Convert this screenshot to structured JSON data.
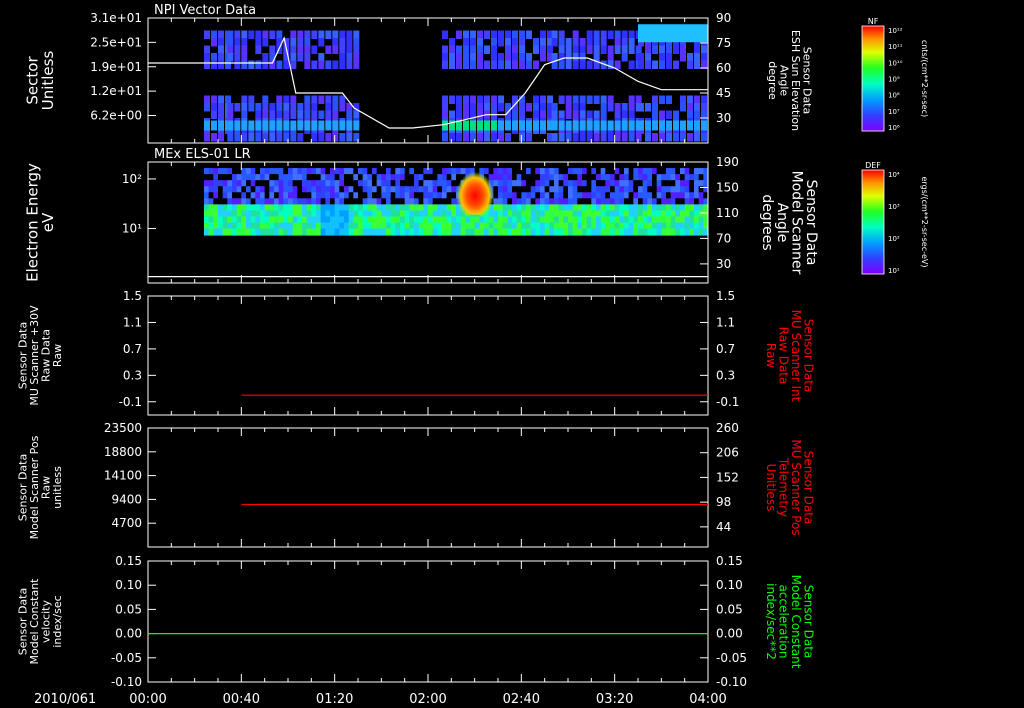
{
  "date_label": "2010/061",
  "time_ticks": [
    "00:00",
    "00:40",
    "01:20",
    "02:00",
    "02:40",
    "03:20",
    "04:00"
  ],
  "colors": {
    "white": "#ffffff",
    "red": "#ff0000",
    "green": "#00ff00"
  },
  "chart_data": [
    {
      "type": "heatmap",
      "title": "NPI Vector Data",
      "ylabel": "Sector\nUnitless",
      "y_ticks": [
        "3.1e+01",
        "2.5e+01",
        "1.9e+01",
        "1.2e+01",
        "6.2e+00"
      ],
      "right_axis": {
        "label": "Sensor Data\nESH Sun Elevation\nAngle\ndegree",
        "ticks": [
          "90",
          "75",
          "60",
          "45",
          "30"
        ],
        "ylim": [
          15,
          90
        ]
      },
      "colorbar": {
        "title": "NF",
        "units": "cnts/(cm**2-sr-sec)",
        "tick_labels": [
          "10¹²",
          "10¹¹",
          "10¹⁰",
          "10⁹",
          "10⁸",
          "10⁷",
          "10⁶"
        ]
      },
      "overlay_line": {
        "color": "#ffffff",
        "points": [
          [
            0,
            63
          ],
          [
            32,
            63
          ],
          [
            35,
            78
          ],
          [
            38,
            45
          ],
          [
            50,
            45
          ],
          [
            53,
            36
          ],
          [
            62,
            24
          ],
          [
            68,
            24
          ],
          [
            76,
            26
          ],
          [
            87,
            32
          ],
          [
            92,
            32
          ],
          [
            97,
            45
          ],
          [
            102,
            62
          ],
          [
            107,
            66
          ],
          [
            113,
            66
          ],
          [
            120,
            60
          ],
          [
            126,
            52
          ],
          [
            132,
            47
          ],
          [
            140,
            47
          ],
          [
            144,
            47
          ]
        ]
      }
    },
    {
      "type": "heatmap",
      "title": "MEx ELS-01 LR",
      "ylabel": "Electron Energy\neV",
      "y_ticks": [
        "10²",
        "10¹"
      ],
      "right_axis": {
        "label": "Sensor Data\nModel Scanner\nAngle\ndegrees",
        "ticks": [
          "190",
          "150",
          "110",
          "70",
          "30"
        ],
        "ylim": [
          0,
          190
        ]
      },
      "colorbar": {
        "title": "DEF",
        "units": "ergs/(cm**2-sr-sec-eV)",
        "tick_labels": [
          "10⁴",
          "10³",
          "10²",
          "10¹"
        ]
      },
      "overlay_line": {
        "color": "#ffffff",
        "points": [
          [
            0,
            10
          ],
          [
            144,
            10
          ]
        ]
      }
    },
    {
      "type": "line",
      "ylabel": "Sensor Data\nMU Scanner +30V\nRaw Data\nRaw",
      "ylim": [
        -0.3,
        1.5
      ],
      "y_ticks": [
        "1.5",
        "1.1",
        "0.7",
        "0.3",
        "-0.1"
      ],
      "right_axis": {
        "label": "Sensor Data\nMU Scanner Int\nRaw Data\nRaw",
        "ticks": [
          "1.5",
          "1.1",
          "0.7",
          "0.3",
          "-0.1"
        ],
        "color": "#ff0000"
      },
      "series": [
        {
          "color": "#ff0000",
          "x": [
            24,
            144
          ],
          "y": [
            0.0,
            0.0
          ]
        }
      ]
    },
    {
      "type": "line",
      "ylabel": "Sensor Data\nModel Scanner Pos\nRaw\nunitless",
      "ylim": [
        0,
        23500
      ],
      "y_ticks": [
        "23500",
        "18800",
        "14100",
        "9400",
        "4700"
      ],
      "right_axis": {
        "label": "Sensor Data\nMU Scanner Pos\nTelemetry\nUnitless",
        "ticks": [
          "260",
          "206",
          "152",
          "98",
          "44"
        ],
        "color": "#ff0000"
      },
      "series": [
        {
          "color": "#ff0000",
          "x": [
            24,
            144
          ],
          "y": [
            8400,
            8400
          ]
        }
      ]
    },
    {
      "type": "line",
      "ylabel": "Sensor Data\nModel Constant\nvelocity\nindex/sec",
      "ylim": [
        -0.1,
        0.15
      ],
      "y_ticks": [
        "0.15",
        "0.10",
        "0.05",
        "0.00",
        "-0.05",
        "-0.10"
      ],
      "right_axis": {
        "label": "Sensor Data\nModel Constant\nacceleration\nindex/sec**2",
        "ticks": [
          "0.15",
          "0.10",
          "0.05",
          "0.00",
          "-0.05",
          "-0.10"
        ],
        "color": "#00ff00"
      },
      "series": [
        {
          "color": "#00ff00",
          "x": [
            0,
            144
          ],
          "y": [
            0.0,
            0.0
          ]
        }
      ]
    }
  ]
}
